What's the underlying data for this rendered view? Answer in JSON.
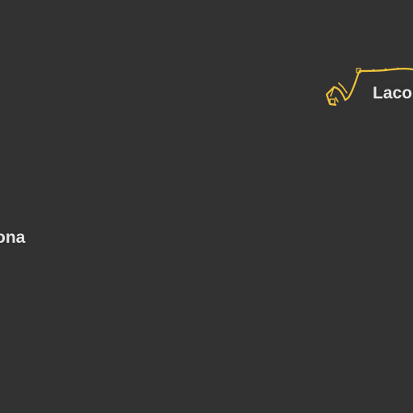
{
  "map": {
    "background_color": "#323232",
    "route_color": "#f0c43a",
    "label_color": "#e6e6e6",
    "labels": {
      "left": "ona",
      "right": "Laco"
    },
    "icons": [
      "road-route-icon",
      "node-icon"
    ]
  }
}
